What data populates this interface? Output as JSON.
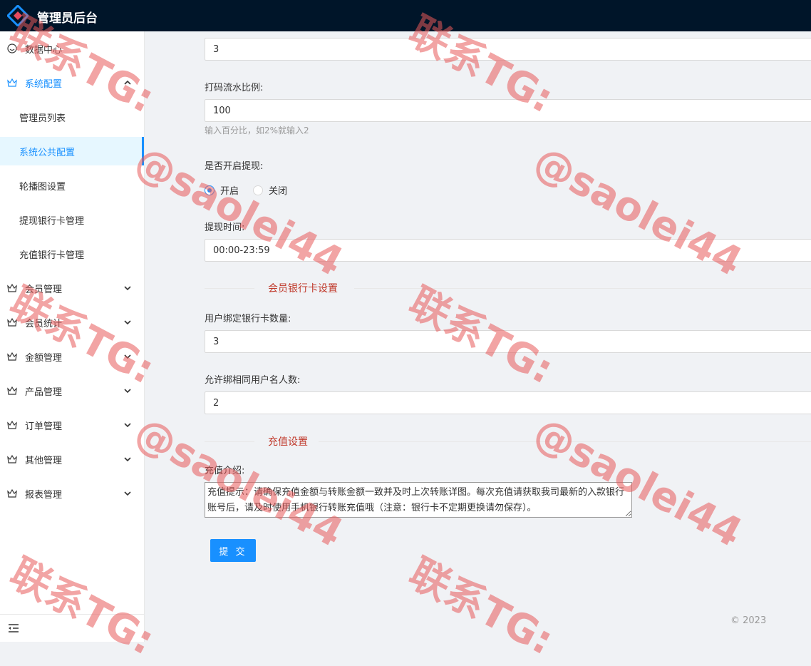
{
  "header": {
    "title": "管理员后台"
  },
  "sidebar": {
    "items": [
      {
        "label": "数据中心",
        "icon": "dashboard-icon"
      },
      {
        "label": "系统配置",
        "icon": "settings-icon",
        "expanded": true,
        "children": [
          {
            "label": "管理员列表"
          },
          {
            "label": "系统公共配置",
            "active": true
          },
          {
            "label": "轮播图设置"
          },
          {
            "label": "提现银行卡管理"
          },
          {
            "label": "充值银行卡管理"
          }
        ]
      },
      {
        "label": "会员管理",
        "icon": "crown-icon"
      },
      {
        "label": "会员统计",
        "icon": "crown-icon"
      },
      {
        "label": "金额管理",
        "icon": "crown-icon"
      },
      {
        "label": "产品管理",
        "icon": "crown-icon"
      },
      {
        "label": "订单管理",
        "icon": "crown-icon"
      },
      {
        "label": "其他管理",
        "icon": "crown-icon"
      },
      {
        "label": "报表管理",
        "icon": "crown-icon"
      }
    ]
  },
  "form": {
    "top_value": "3",
    "bet_ratio": {
      "label": "打码流水比例:",
      "value": "100",
      "hint": "输入百分比，如2%就输入2"
    },
    "withdraw_enabled": {
      "label": "是否开启提现:",
      "options": [
        "开启",
        "关闭"
      ],
      "selected": "开启"
    },
    "withdraw_time": {
      "label": "提现时间:",
      "value": "00:00-23:59"
    },
    "section_bank": "会员银行卡设置",
    "bank_card_count": {
      "label": "用户绑定银行卡数量:",
      "value": "3"
    },
    "same_name_count": {
      "label": "允许绑相同用户名人数:",
      "value": "2"
    },
    "section_recharge": "充值设置",
    "recharge_intro": {
      "label": "充值介绍:",
      "value": "充值提示：请确保充值金额与转账金额一致并及时上次转账详图。每次充值请获取我司最新的入款银行账号后，请及时使用手机银行转账充值哦（注意：银行卡不定期更换请勿保存）。"
    },
    "submit_label": "提 交"
  },
  "footer": {
    "copyright": "© 2023"
  },
  "watermark": {
    "line1": "联系TG:",
    "line2": "@saolei44"
  },
  "colors": {
    "primary": "#1890ff",
    "header_bg": "#001529",
    "divider_text": "#c0392b",
    "watermark": "#e85a5a"
  }
}
